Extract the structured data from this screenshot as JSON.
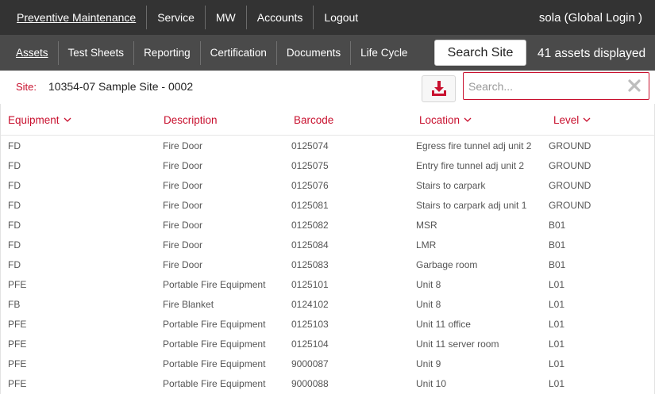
{
  "topnav": {
    "items": [
      {
        "label": "Preventive Maintenance",
        "active": true
      },
      {
        "label": "Service",
        "active": false
      },
      {
        "label": "MW",
        "active": false
      },
      {
        "label": "Accounts",
        "active": false
      },
      {
        "label": "Logout",
        "active": false
      }
    ],
    "user": "sola (Global Login )"
  },
  "subnav": {
    "items": [
      {
        "label": "Assets",
        "active": true
      },
      {
        "label": "Test Sheets",
        "active": false
      },
      {
        "label": "Reporting",
        "active": false
      },
      {
        "label": "Certification",
        "active": false
      },
      {
        "label": "Documents",
        "active": false
      },
      {
        "label": "Life Cycle",
        "active": false
      }
    ],
    "search_site_label": "Search Site",
    "assets_count": "41 assets displayed"
  },
  "site": {
    "label": "Site:",
    "value": "10354-07 Sample Site - 0002"
  },
  "search": {
    "placeholder": "Search...",
    "value": ""
  },
  "table": {
    "headers": {
      "equipment": "Equipment",
      "description": "Description",
      "barcode": "Barcode",
      "location": "Location",
      "level": "Level"
    },
    "rows": [
      {
        "equipment": "FD",
        "description": "Fire Door",
        "barcode": "0125074",
        "location": "Egress fire tunnel adj unit 2",
        "level": "GROUND"
      },
      {
        "equipment": "FD",
        "description": "Fire Door",
        "barcode": "0125075",
        "location": "Entry fire tunnel adj unit 2",
        "level": "GROUND"
      },
      {
        "equipment": "FD",
        "description": "Fire Door",
        "barcode": "0125076",
        "location": "Stairs to carpark",
        "level": "GROUND"
      },
      {
        "equipment": "FD",
        "description": "Fire Door",
        "barcode": "0125081",
        "location": "Stairs to carpark adj unit 1",
        "level": "GROUND"
      },
      {
        "equipment": "FD",
        "description": "Fire Door",
        "barcode": "0125082",
        "location": "MSR",
        "level": "B01"
      },
      {
        "equipment": "FD",
        "description": "Fire Door",
        "barcode": "0125084",
        "location": "LMR",
        "level": "B01"
      },
      {
        "equipment": "FD",
        "description": "Fire Door",
        "barcode": "0125083",
        "location": "Garbage room",
        "level": "B01"
      },
      {
        "equipment": "PFE",
        "description": "Portable Fire Equipment",
        "barcode": "0125101",
        "location": "Unit 8",
        "level": "L01"
      },
      {
        "equipment": "FB",
        "description": "Fire Blanket",
        "barcode": "0124102",
        "location": "Unit 8",
        "level": "L01"
      },
      {
        "equipment": "PFE",
        "description": "Portable Fire Equipment",
        "barcode": "0125103",
        "location": "Unit 11 office",
        "level": "L01"
      },
      {
        "equipment": "PFE",
        "description": "Portable Fire Equipment",
        "barcode": "0125104",
        "location": "Unit 11 server room",
        "level": "L01"
      },
      {
        "equipment": "PFE",
        "description": "Portable Fire Equipment",
        "barcode": "9000087",
        "location": "Unit 9",
        "level": "L01"
      },
      {
        "equipment": "PFE",
        "description": "Portable Fire Equipment",
        "barcode": "9000088",
        "location": "Unit 10",
        "level": "L01"
      }
    ]
  },
  "colors": {
    "accent": "#c8102e",
    "topbar": "#333333",
    "subbar": "#4a4a4a"
  },
  "icons": {
    "download": "download-icon",
    "clear": "close-icon",
    "sort": "chevron-down-icon"
  }
}
